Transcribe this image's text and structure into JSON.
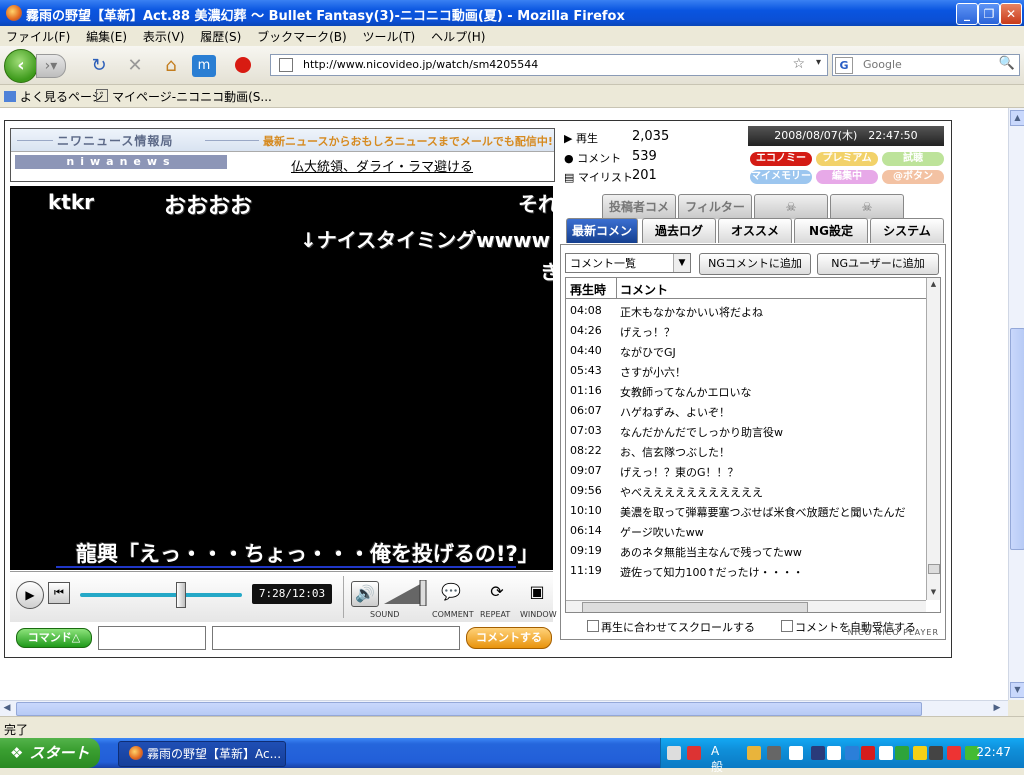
{
  "window": {
    "title": "霧雨の野望【革新】Act.88 美濃幻葬 ～ Bullet Fantasy(3)‐ニコニコ動画(夏) - Mozilla Firefox"
  },
  "menu": [
    "ファイル(F)",
    "編集(E)",
    "表示(V)",
    "履歴(S)",
    "ブックマーク(B)",
    "ツール(T)",
    "ヘルプ(H)"
  ],
  "nav": {
    "url": "http://www.nicovideo.jp/watch/sm4205544",
    "search_placeholder": "Google",
    "search_engine": "G"
  },
  "bookmarks": [
    "よく見るページ",
    "マイページ‐ニコニコ動画(S..."
  ],
  "news": {
    "banner_left": "ニワニュース情報局",
    "banner_right": "最新ニュースからおもしろニュースまでメールでも配信中!",
    "logo": "niwanews",
    "headline": "仏大統領、ダライ・ラマ避ける"
  },
  "video": {
    "comments": [
      {
        "text": "ktkr"
      },
      {
        "text": "おおおお"
      },
      {
        "text": "それ"
      },
      {
        "text": "↓ナイスタイミングwwww"
      },
      {
        "text": "き"
      }
    ],
    "subtitle": "龍興「えっ・・・ちょっ・・・俺を投げるの!?」"
  },
  "controls": {
    "time": "7:28/12:03",
    "progress": 0.62,
    "labels": {
      "sound": "SOUND",
      "comment": "COMMENT",
      "repeat": "REPEAT",
      "window": "WINDOW"
    },
    "command_button": "コマンド△",
    "send_button": "コメントする"
  },
  "stats": {
    "views_label": "再生",
    "views": "2,035",
    "comments_label": "コメント",
    "comments": "539",
    "mylist_label": "マイリスト",
    "mylist": "201"
  },
  "date": "2008/08/07(木)　22:47:50",
  "badges": [
    "エコノミー",
    "プレミアム",
    "試聴",
    "マイメモリー",
    "編集中",
    "@ボタン"
  ],
  "tabs_top": [
    "投稿者コメ",
    "フィルター"
  ],
  "tabs": [
    "最新コメント",
    "過去ログ",
    "オススメ",
    "NG設定",
    "システム"
  ],
  "comment_panel": {
    "select_value": "コメント一覧",
    "ng_comment_button": "NGコメントに追加",
    "ng_user_button": "NGユーザーに追加",
    "col_time": "再生時",
    "col_comment": "コメント",
    "rows": [
      {
        "time": "04:08",
        "text": "正木もなかなかいい将だよね"
      },
      {
        "time": "04:26",
        "text": "げえっ！？"
      },
      {
        "time": "04:40",
        "text": "ながひでGJ"
      },
      {
        "time": "05:43",
        "text": "さすが小六！"
      },
      {
        "time": "01:16",
        "text": "女教師ってなんかエロいな"
      },
      {
        "time": "06:07",
        "text": "ハゲねずみ、よいぞ！"
      },
      {
        "time": "07:03",
        "text": "なんだかんだでしっかり助言役w"
      },
      {
        "time": "08:22",
        "text": "お、信玄隊つぶした！"
      },
      {
        "time": "09:07",
        "text": "げえっ！？東のG！！？"
      },
      {
        "time": "09:56",
        "text": "やべえええええええええええ"
      },
      {
        "time": "10:10",
        "text": "美濃を取って弾幕要塞つぶせば米食べ放題だと聞いたんだ"
      },
      {
        "time": "06:14",
        "text": "ゲージ吹いたww"
      },
      {
        "time": "09:19",
        "text": "あのネタ無能当主なんで残ってたww"
      },
      {
        "time": "11:19",
        "text": "遊佐って知力100↑だったけ・・・・"
      }
    ],
    "scroll_label": "再生に合わせてスクロールする",
    "auto_receive_label": "コメントを自動受信する",
    "player_logo": "NICO NICO PLAYER"
  },
  "status": "完了",
  "taskbar": {
    "start": "スタート",
    "item": "霧雨の野望【革新】Ac...",
    "clock": "22:47"
  }
}
